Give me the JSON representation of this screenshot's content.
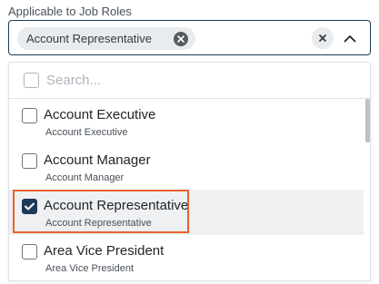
{
  "field": {
    "label": "Applicable to Job Roles"
  },
  "selected_chip": {
    "label": "Account Representative"
  },
  "search": {
    "placeholder": "Search...",
    "value": ""
  },
  "options": [
    {
      "title": "Account Executive",
      "subtitle": "Account Executive",
      "checked": false
    },
    {
      "title": "Account Manager",
      "subtitle": "Account Manager",
      "checked": false
    },
    {
      "title": "Account Representative",
      "subtitle": "Account Representative",
      "checked": true
    },
    {
      "title": "Area Vice President",
      "subtitle": "Area Vice President",
      "checked": false
    }
  ],
  "colors": {
    "accent": "#1c3a57",
    "highlight": "#e8622c",
    "chip": "#e9ecef"
  },
  "icons": {
    "chip_remove": "close-circle-icon",
    "clear_all": "close-icon",
    "toggle": "chevron-up-icon",
    "check": "check-icon"
  }
}
